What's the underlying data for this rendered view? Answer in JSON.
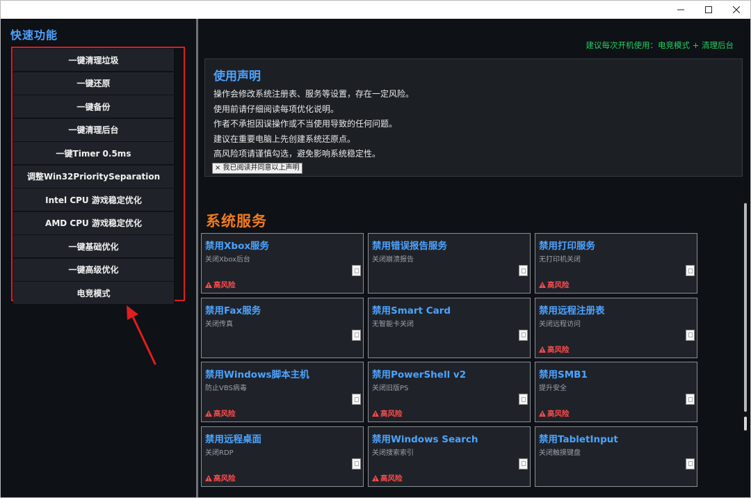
{
  "quick": {
    "title": "快速功能",
    "items": [
      "一键清理垃圾",
      "一键还原",
      "一键备份",
      "一键清理后台",
      "一键Timer 0.5ms",
      "调整Win32PrioritySeparation",
      "Intel CPU 游戏稳定优化",
      "AMD CPU 游戏稳定优化",
      "一键基础优化",
      "一键高级优化",
      "电竞模式"
    ]
  },
  "header": {
    "recommend": "建议每次开机使用：电竞模式 + 清理后台"
  },
  "notice": {
    "title": "使用声明",
    "lines": [
      "操作会修改系统注册表、服务等设置，存在一定风险。",
      "使用前请仔细阅读每项优化说明。",
      "作者不承担因误操作或不当使用导致的任何问题。",
      "建议在重要电脑上先创建系统还原点。",
      "高风险项请谨慎勾选，避免影响系统稳定性。"
    ],
    "agree_label": "× 我已阅读并同意以上声明"
  },
  "services": {
    "title": "系统服务",
    "risk_label": "高风险",
    "cards": [
      {
        "title": "禁用Xbox服务",
        "desc": "关闭Xbox后台",
        "risk": true
      },
      {
        "title": "禁用错误报告服务",
        "desc": "关闭崩溃报告",
        "risk": false
      },
      {
        "title": "禁用打印服务",
        "desc": "无打印机关闭",
        "risk": true
      },
      {
        "title": "禁用Fax服务",
        "desc": "关闭传真",
        "risk": false
      },
      {
        "title": "禁用Smart Card",
        "desc": "无智能卡关闭",
        "risk": false
      },
      {
        "title": "禁用远程注册表",
        "desc": "关闭远程访问",
        "risk": true
      },
      {
        "title": "禁用Windows脚本主机",
        "desc": "防止VBS病毒",
        "risk": true
      },
      {
        "title": "禁用PowerShell v2",
        "desc": "关闭旧版PS",
        "risk": true
      },
      {
        "title": "禁用SMB1",
        "desc": "提升安全",
        "risk": true
      },
      {
        "title": "禁用远程桌面",
        "desc": "关闭RDP",
        "risk": true
      },
      {
        "title": "禁用Windows Search",
        "desc": "关闭搜索索引",
        "risk": true
      },
      {
        "title": "禁用TabletInput",
        "desc": "关闭触摸键盘",
        "risk": false
      }
    ]
  },
  "colors": {
    "accent": "#4da3ff",
    "section": "#f07c1e",
    "risk": "#ff4b4b",
    "recommend": "#22d060",
    "highlight_box": "#e01e1e"
  }
}
